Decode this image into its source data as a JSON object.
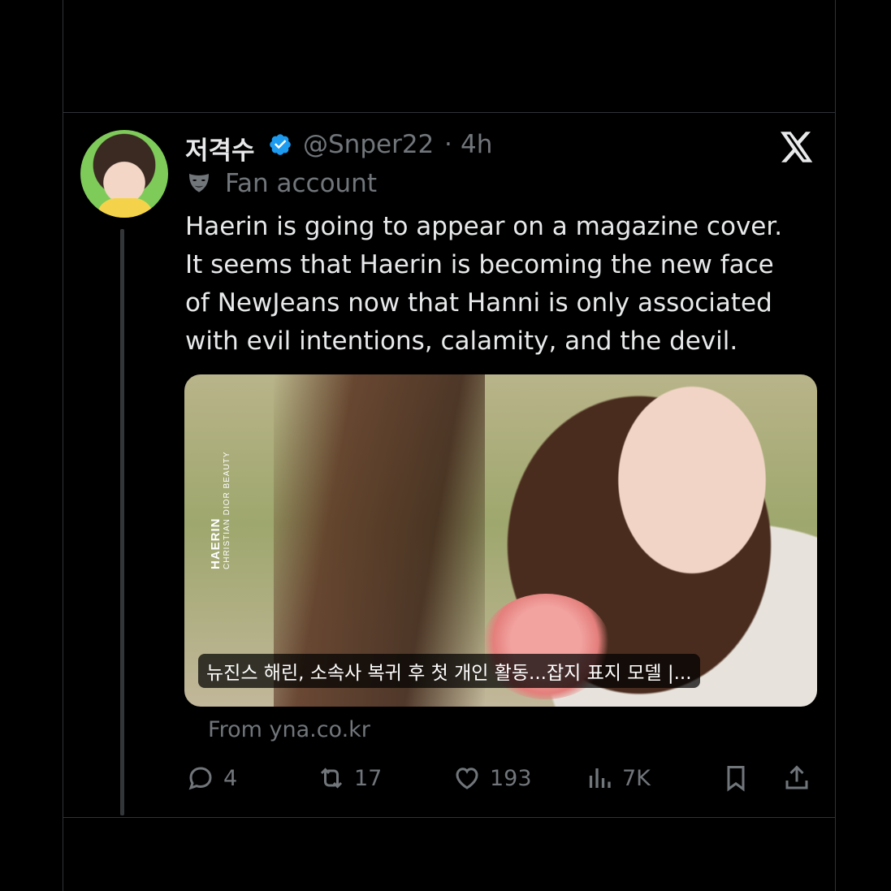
{
  "tweet": {
    "display_name": "저격수",
    "handle": "@Snper22",
    "separator": "·",
    "time": "4h",
    "label": "Fan account",
    "text": "Haerin is going to appear on a magazine cover.\nIt seems that Haerin is becoming the new face\nof NewJeans now that Hanni is only associated\nwith evil intentions, calamity, and the devil.",
    "card": {
      "title": "뉴진스 해린, 소속사 복귀 후 첫 개인 활동...잡지 표지 모델 |...",
      "image_text_1": "HAERIN",
      "image_text_2": "CHRISTIAN DIOR BEAUTY"
    },
    "source": "From yna.co.kr"
  },
  "actions": {
    "replies": "4",
    "reposts": "17",
    "likes": "193",
    "views": "7K"
  },
  "colors": {
    "background": "#000000",
    "text": "#e7e9ea",
    "muted": "#71767b",
    "verified": "#1d9bf0"
  },
  "icons": [
    "verified-badge-icon",
    "x-logo-icon",
    "mask-icon",
    "reply-icon",
    "repost-icon",
    "like-icon",
    "views-icon",
    "bookmark-icon",
    "share-icon"
  ]
}
